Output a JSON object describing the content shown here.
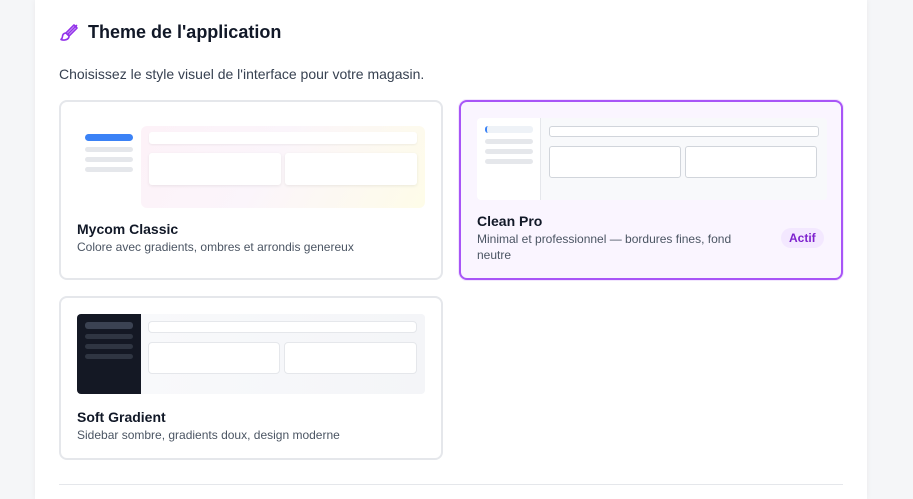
{
  "section": {
    "title": "Theme de l'application",
    "icon": "paintbrush-icon",
    "description": "Choisissez le style visuel de l'interface pour votre magasin."
  },
  "themes": [
    {
      "name": "Mycom Classic",
      "description": "Colore avec gradients, ombres et arrondis genereux",
      "active": false
    },
    {
      "name": "Clean Pro",
      "description": "Minimal et professionnel — bordures fines, fond neutre",
      "active": true,
      "badge": "Actif"
    },
    {
      "name": "Soft Gradient",
      "description": "Sidebar sombre, gradients doux, design moderne",
      "active": false
    }
  ],
  "colors": {
    "accent": "#a855f7",
    "badge_bg": "#f3e8ff",
    "badge_text": "#7e22ce",
    "classic_nav": "#3b82f6",
    "dark_sidebar": "#141824"
  }
}
